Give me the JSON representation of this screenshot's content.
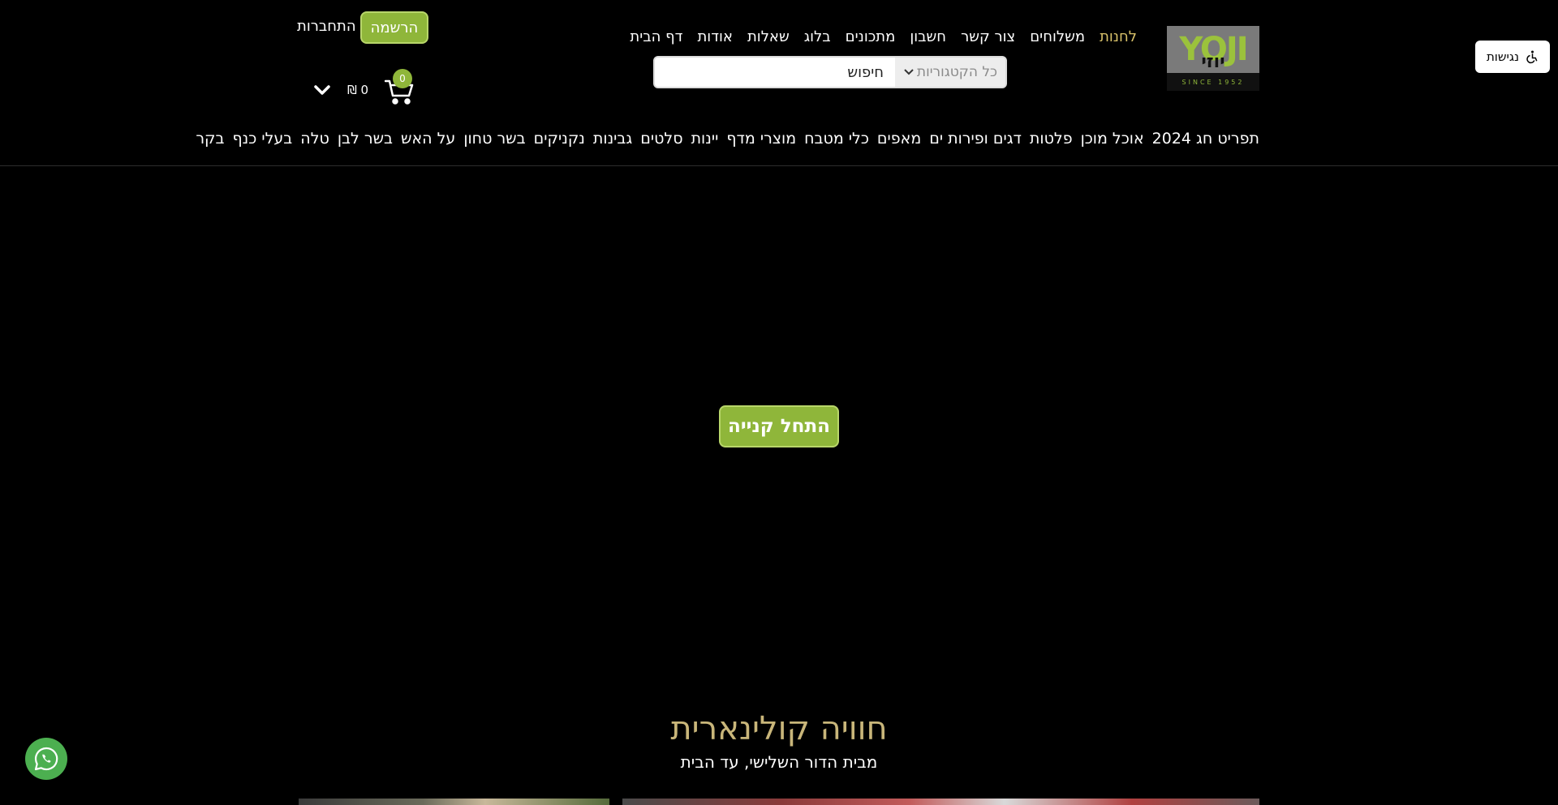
{
  "accessibility": {
    "label": "נגישות"
  },
  "logo": {
    "latin": "YOJI",
    "hebrew": "יוזי",
    "since": "SINCE 1952"
  },
  "top_nav": {
    "items": [
      {
        "label": "דף הבית",
        "active": false
      },
      {
        "label": "אודות",
        "active": false
      },
      {
        "label": "שאלות",
        "active": false
      },
      {
        "label": "בלוג",
        "active": false
      },
      {
        "label": "מתכונים",
        "active": false
      },
      {
        "label": "חשבון",
        "active": false
      },
      {
        "label": "צור קשר",
        "active": false
      },
      {
        "label": "משלוחים",
        "active": false
      },
      {
        "label": "לחנות",
        "active": true
      }
    ]
  },
  "search": {
    "placeholder": "חיפוש",
    "category_selected": "כל הקטגוריות"
  },
  "auth": {
    "register_label": "הרשמה",
    "login_label": "התחברות"
  },
  "cart": {
    "count": "0",
    "total": "0 ₪"
  },
  "categories": [
    "בקר",
    "בעלי כנף",
    "טלה",
    "בשר לבן",
    "על האש",
    "בשר טחון",
    "נקניקים",
    "גבינות",
    "סלטים",
    "יינות",
    "מוצרי מדף",
    "כלי מטבח",
    "מאפים",
    "דגים ופירות ים",
    "פלטות",
    "אוכל מוכן",
    "תפריט חג 2024"
  ],
  "hero": {
    "cta_label": "התחל קנייה"
  },
  "section": {
    "title": "חוויה קולינארית",
    "subtitle": "מבית הדור השלישי, עד הבית"
  },
  "colors": {
    "accent": "#8fb63a",
    "gold": "#c9b67a",
    "active_nav": "#d9c26a",
    "whatsapp": "#4caf50"
  },
  "icons": [
    "wheelchair-icon",
    "chevron-down-icon",
    "cart-icon",
    "whatsapp-icon"
  ]
}
